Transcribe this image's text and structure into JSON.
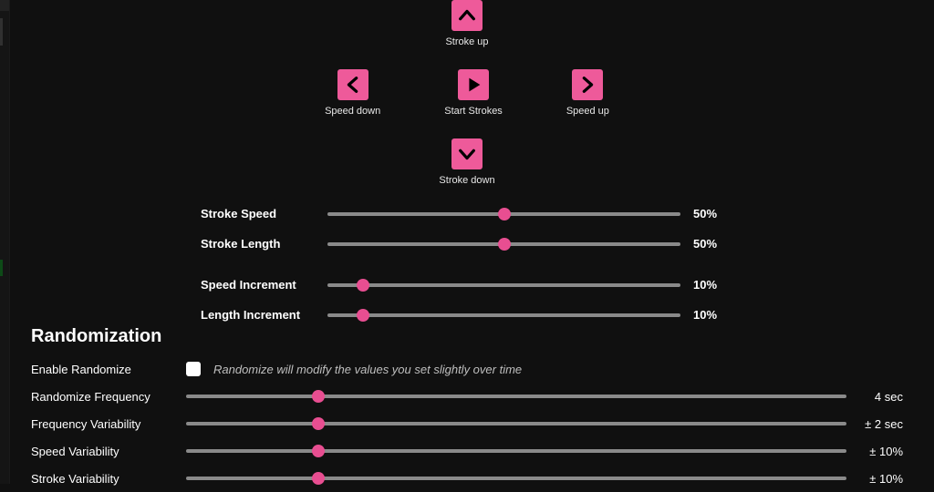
{
  "pad": {
    "stroke_up": "Stroke up",
    "speed_down": "Speed down",
    "start_strokes": "Start Strokes",
    "speed_up": "Speed up",
    "stroke_down": "Stroke down"
  },
  "sliders": {
    "stroke_speed": {
      "label": "Stroke Speed",
      "value": "50%",
      "pct": 50
    },
    "stroke_length": {
      "label": "Stroke Length",
      "value": "50%",
      "pct": 50
    },
    "speed_inc": {
      "label": "Speed Increment",
      "value": "10%",
      "pct": 10
    },
    "length_inc": {
      "label": "Length Increment",
      "value": "10%",
      "pct": 10
    }
  },
  "rand": {
    "title": "Randomization",
    "enable_label": "Enable Randomize",
    "enable_help": "Randomize will modify the values you set slightly over time",
    "freq": {
      "label": "Randomize Frequency",
      "value": "4 sec",
      "pct": 20
    },
    "freq_var": {
      "label": "Frequency Variability",
      "value": "± 2 sec",
      "pct": 20
    },
    "speed_var": {
      "label": "Speed Variability",
      "value": "± 10%",
      "pct": 20
    },
    "stroke_var": {
      "label": "Stroke Variability",
      "value": "± 10%",
      "pct": 20
    }
  }
}
